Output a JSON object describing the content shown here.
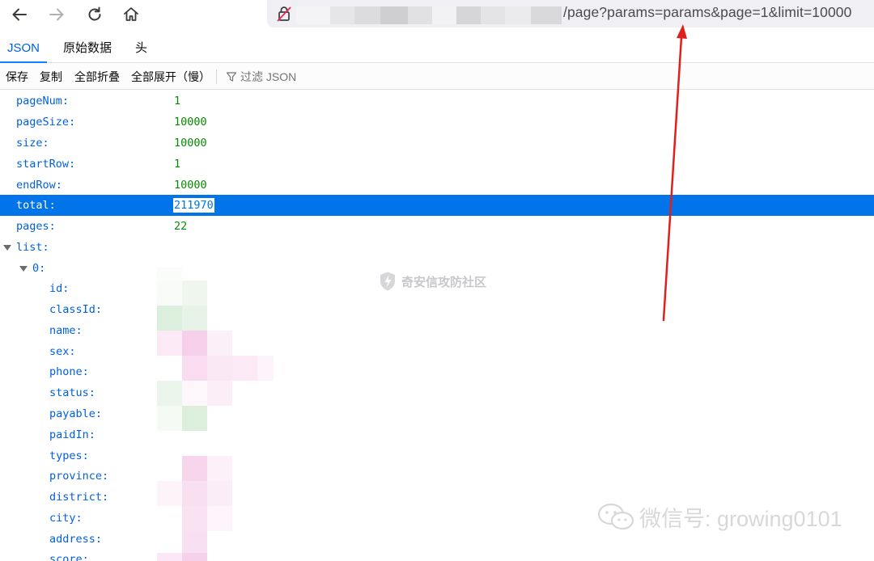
{
  "browser": {
    "url_visible": "/page?params=params&page=1&limit=10000"
  },
  "viewer": {
    "tabs": [
      {
        "label": "JSON",
        "active": true
      },
      {
        "label": "原始数据",
        "active": false
      },
      {
        "label": "头",
        "active": false
      }
    ],
    "toolbar": {
      "save": "保存",
      "copy": "复制",
      "collapse_all": "全部折叠",
      "expand_all": "全部展开（慢）",
      "filter_placeholder": "过滤 JSON"
    }
  },
  "json_tree": {
    "rows": [
      {
        "key": "pageNum:",
        "value": "1"
      },
      {
        "key": "pageSize:",
        "value": "10000"
      },
      {
        "key": "size:",
        "value": "10000"
      },
      {
        "key": "startRow:",
        "value": "1"
      },
      {
        "key": "endRow:",
        "value": "10000"
      },
      {
        "key": "total:",
        "value": "211970",
        "selected": true
      },
      {
        "key": "pages:",
        "value": "22"
      },
      {
        "key": "list:",
        "expandable": true
      },
      {
        "key": "0:",
        "expandable": true
      },
      {
        "key": "id:"
      },
      {
        "key": "classId:"
      },
      {
        "key": "name:"
      },
      {
        "key": "sex:"
      },
      {
        "key": "phone:"
      },
      {
        "key": "status:"
      },
      {
        "key": "payable:"
      },
      {
        "key": "paidIn:"
      },
      {
        "key": "types:"
      },
      {
        "key": "province:"
      },
      {
        "key": "district:"
      },
      {
        "key": "city:"
      },
      {
        "key": "address:"
      },
      {
        "key": "score:"
      }
    ]
  },
  "overlays": {
    "watermark": "奇安信攻防社区",
    "wechat_caption": "微信号: growing0101",
    "arrow_color": "#e0201c"
  }
}
